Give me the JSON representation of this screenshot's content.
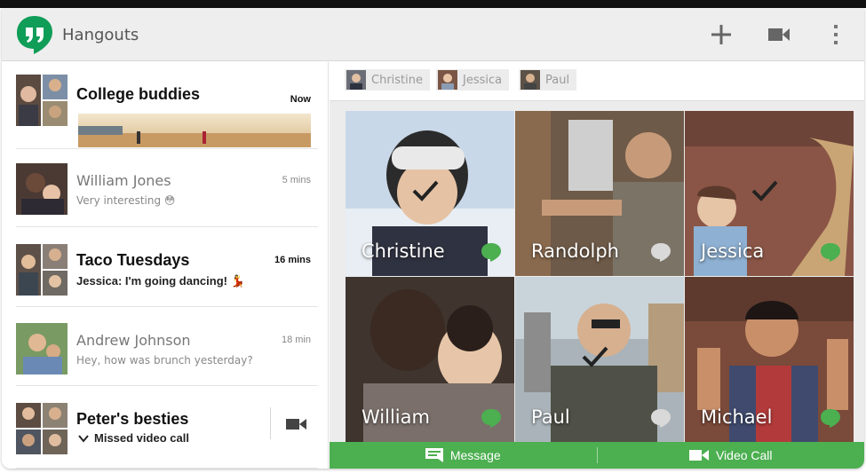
{
  "app": {
    "title": "Hangouts"
  },
  "actionbar": {
    "icons": [
      "add-icon",
      "video-camera-icon",
      "overflow-menu-icon"
    ],
    "accent": "#0f9d58"
  },
  "conversations": [
    {
      "name": "College buddies",
      "time": "Now",
      "message": "",
      "unread": true,
      "has_photo": true
    },
    {
      "name": "William Jones",
      "time": "5 mins",
      "message": "Very interesting 😳",
      "unread": false
    },
    {
      "name": "Taco Tuesdays",
      "time": "16 mins",
      "message": "Jessica: I'm going dancing! 💃",
      "unread": true
    },
    {
      "name": "Andrew Johnson",
      "time": "18 min",
      "message": "Hey, how was brunch yesterday?",
      "unread": false
    },
    {
      "name": "Peter's besties",
      "time": "",
      "message": "Missed video call",
      "unread": true,
      "action_icon": "video-camera-icon"
    }
  ],
  "participants_bar": [
    {
      "name": "Christine"
    },
    {
      "name": "Jessica"
    },
    {
      "name": "Paul"
    }
  ],
  "tiles": [
    {
      "name": "Christine",
      "selected": true,
      "online": true
    },
    {
      "name": "Randolph",
      "selected": false,
      "online": false
    },
    {
      "name": "Jessica",
      "selected": true,
      "online": true
    },
    {
      "name": "William",
      "selected": false,
      "online": true
    },
    {
      "name": "Paul",
      "selected": true,
      "online": false
    },
    {
      "name": "Michael",
      "selected": false,
      "online": true
    }
  ],
  "bottom_actions": {
    "message_label": "Message",
    "video_call_label": "Video Call",
    "color": "#4caf50"
  }
}
